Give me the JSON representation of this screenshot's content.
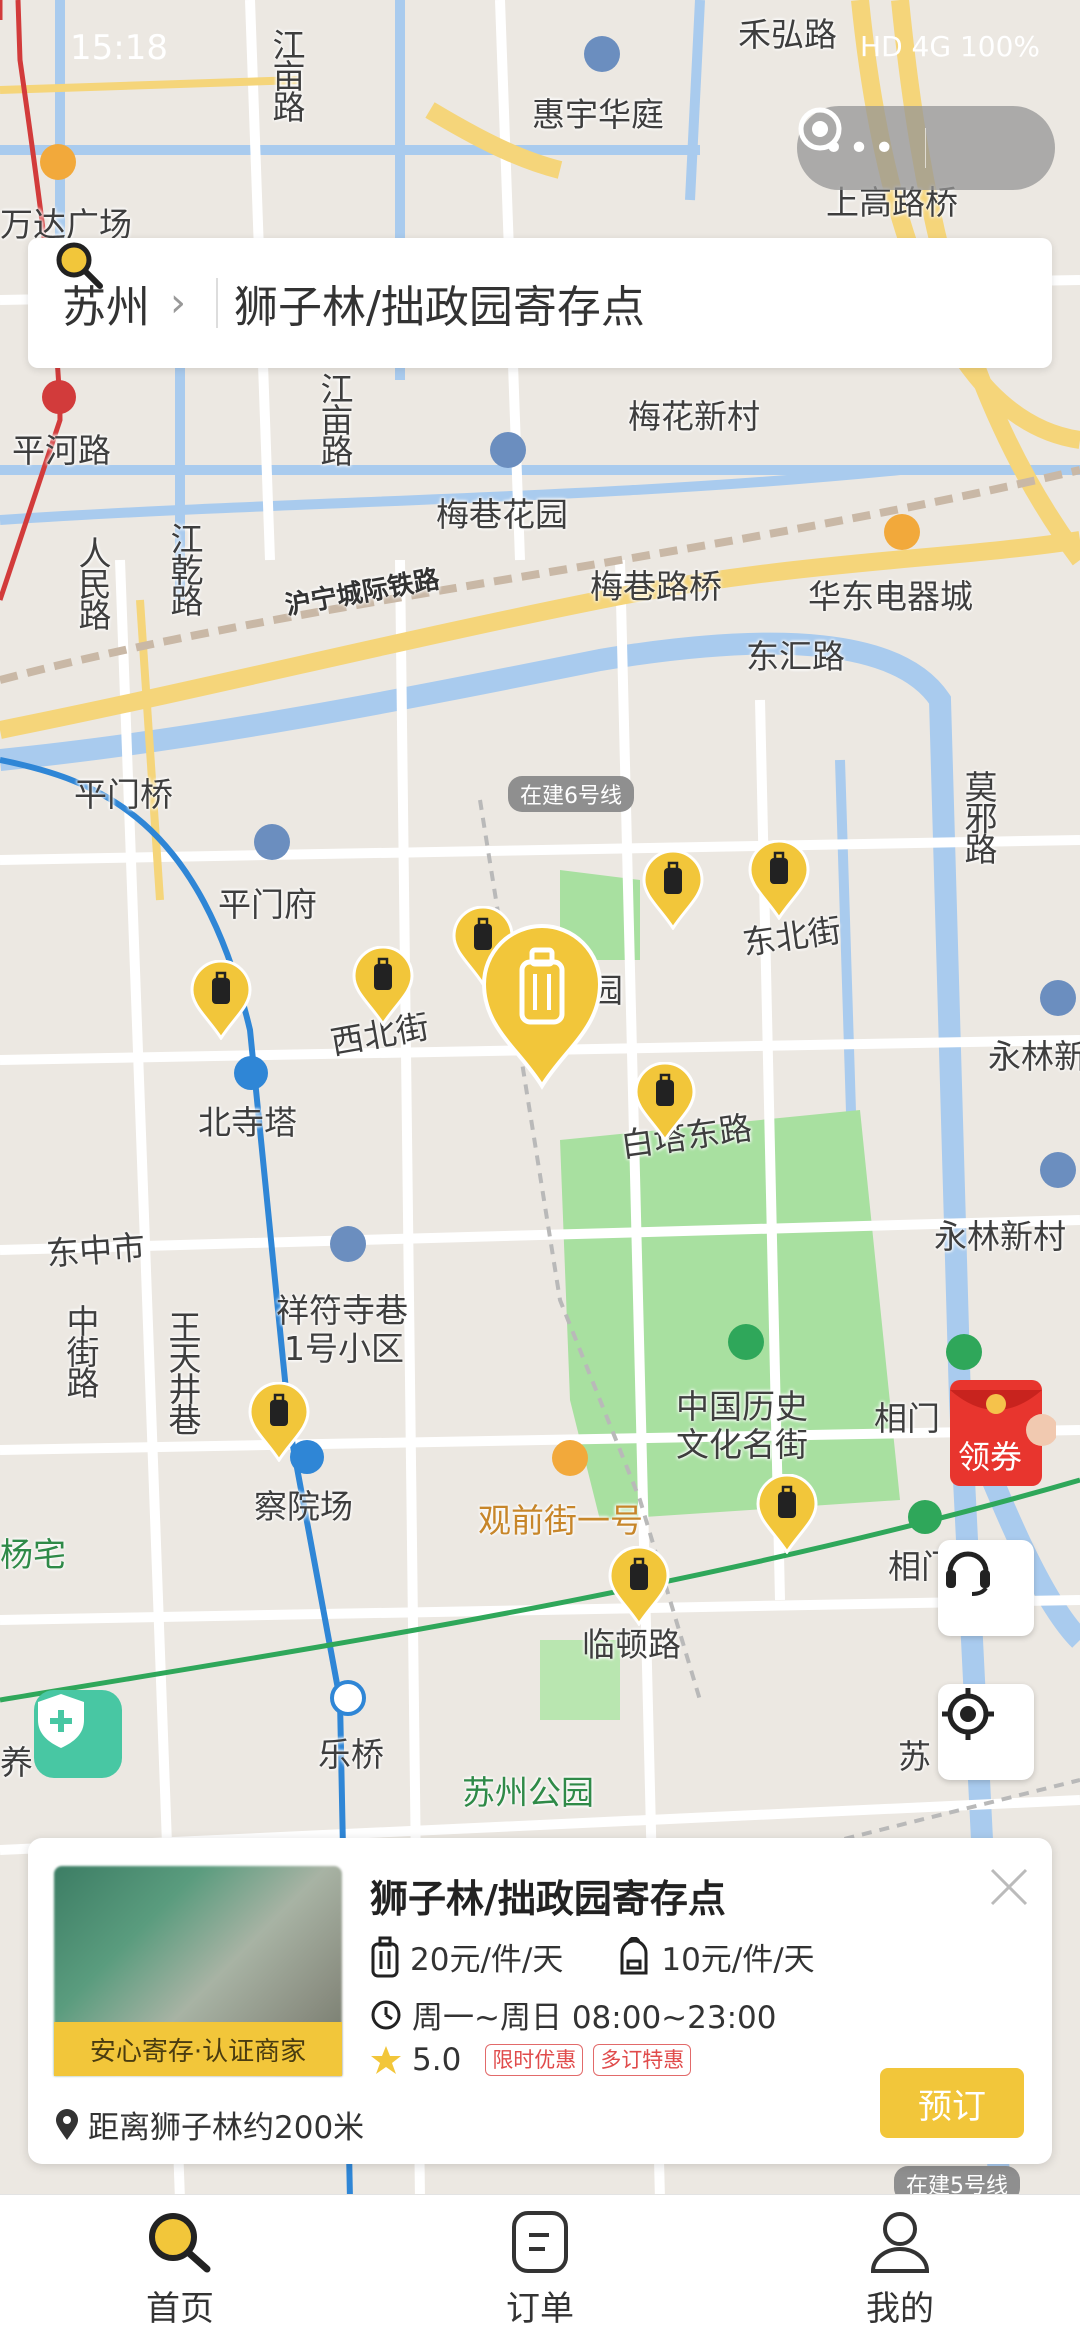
{
  "status": {
    "time": "15:18",
    "right": "HD  4G  100%"
  },
  "search": {
    "city": "苏州",
    "query": "狮子林/拙政园寄存点"
  },
  "map": {
    "labels": {
      "jiangmiao_top": "江亩路",
      "huiyu": "惠宇华庭",
      "hehong": "禾弘路",
      "wanda": "万达广场",
      "shanggao": "上高路桥",
      "pinghe": "平河路",
      "renmin": "人民路",
      "jiangmiao": "江亩路",
      "meihua": "梅花新村",
      "meixiang_garden": "梅巷花园",
      "jianggan": "江乾路",
      "hunning": "沪宁城际铁路",
      "meixiang_bridge": "梅巷路桥",
      "huadong": "华东电器城",
      "donghui": "东汇路",
      "pingmen_bridge": "平门桥",
      "building6": "在建6号线",
      "moxie": "莫邪路",
      "pingmen_fu": "平门府",
      "dongbei": "东北街",
      "yonglin": "永林新",
      "xibei": "西北街",
      "beisi": "北寺塔",
      "baita": "白塔东路",
      "dongzhong": "东中市",
      "yonglin_village": "永林新村",
      "xiangfu": "祥符寺巷",
      "xiangfu2": "1号小区",
      "zhongjie": "中街路",
      "wangtian": "王天井巷",
      "zhongguo1": "中国历史",
      "zhongguo2": "文化名街",
      "xiangmen": "相门",
      "chayuan": "察院场",
      "guanqian": "观前街一号",
      "yangzhai": "杨宅",
      "lindun": "临顿路",
      "xiangmen2": "相门",
      "leqiao": "乐桥",
      "su": "苏",
      "yang": "养",
      "park": "苏州公园",
      "building5": "在建5号线",
      "yuan": "园"
    },
    "coupon_label": "领券"
  },
  "card": {
    "title": "狮子林/拙政园寄存点",
    "photo_badge": "安心寄存·认证商家",
    "price_luggage": "20元/件/天",
    "price_bag": "10元/件/天",
    "hours": "周一~周日 08:00~23:00",
    "rating": "5.0",
    "badge_limited": "限时优惠",
    "badge_multi": "多订特惠",
    "book_label": "预订",
    "distance": "距离狮子林约200米"
  },
  "tabs": [
    {
      "label": "首页",
      "icon": "search-icon"
    },
    {
      "label": "订单",
      "icon": "order-icon"
    },
    {
      "label": "我的",
      "icon": "user-icon"
    }
  ],
  "colors": {
    "accent": "#f2c63a",
    "metro_blue": "#2f86d6",
    "metro_green": "#2fa75a",
    "water": "#a9cbee",
    "park": "#a8e0a0",
    "road_major": "#f5d57a"
  }
}
